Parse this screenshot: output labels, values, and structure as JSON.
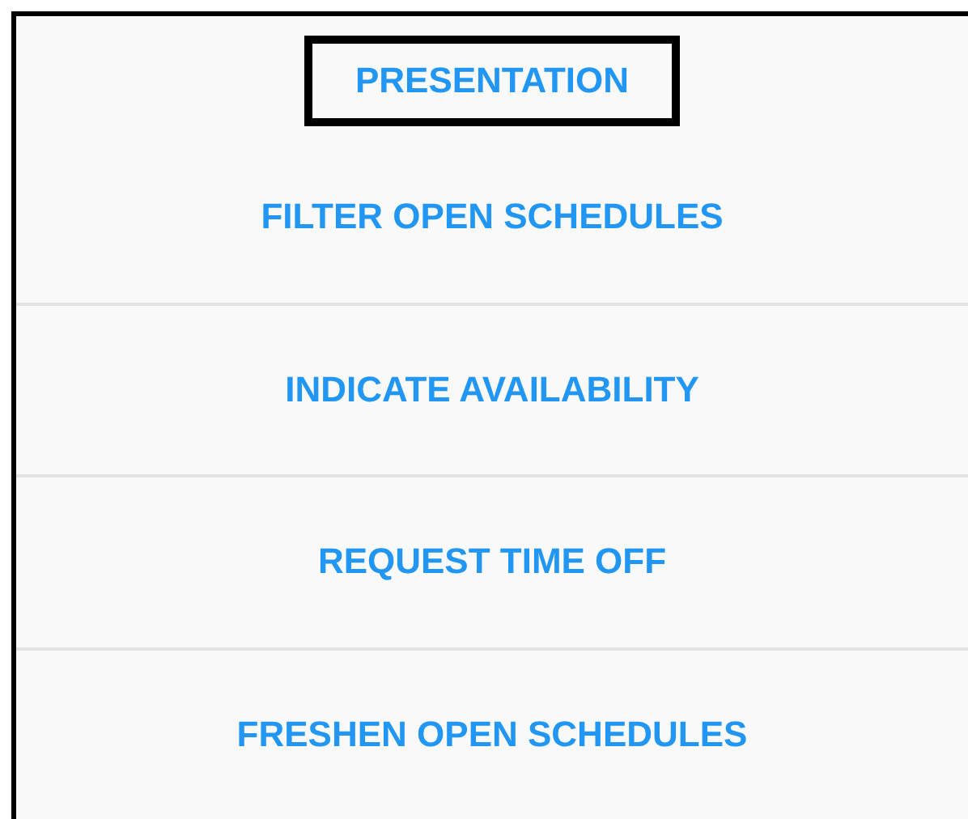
{
  "menu": {
    "items": [
      {
        "kind": "heading",
        "label": "PRESENTATION",
        "selected": true
      },
      {
        "kind": "action",
        "label": "FILTER OPEN SCHEDULES",
        "selected": false
      },
      {
        "kind": "action",
        "label": "INDICATE AVAILABILITY",
        "selected": false
      },
      {
        "kind": "action",
        "label": "REQUEST TIME OFF",
        "selected": false
      },
      {
        "kind": "action",
        "label": "FRESHEN OPEN SCHEDULES",
        "selected": false
      }
    ]
  }
}
